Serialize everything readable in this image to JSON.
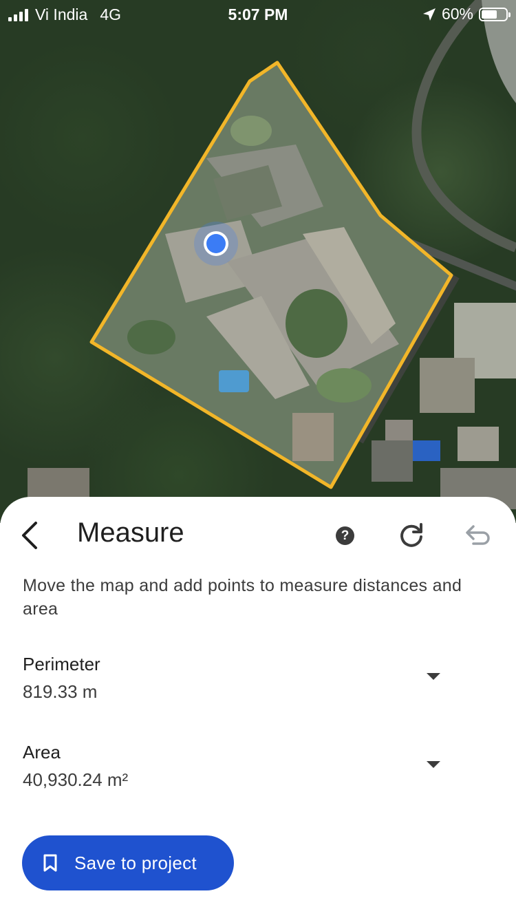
{
  "status_bar": {
    "carrier": "Vi India",
    "network": "4G",
    "time": "5:07 PM",
    "battery_percent": "60%",
    "battery_level": 0.6
  },
  "map": {
    "polygon_color": "#f2b629",
    "location_dot_color": "#3b7cf5",
    "icons": [
      "location-dot-icon"
    ]
  },
  "sheet": {
    "title": "Measure",
    "description": "Move the map and add points to measure distances and area",
    "perimeter": {
      "label": "Perimeter",
      "value": "819.33 m"
    },
    "area": {
      "label": "Area",
      "value": "40,930.24 m²"
    },
    "save_label": "Save to project",
    "accent_color": "#1f52cf",
    "icons": [
      "back-arrow-icon",
      "help-icon",
      "refresh-icon",
      "undo-icon",
      "chevron-down-icon",
      "bookmark-icon"
    ],
    "help_glyph": "?"
  }
}
